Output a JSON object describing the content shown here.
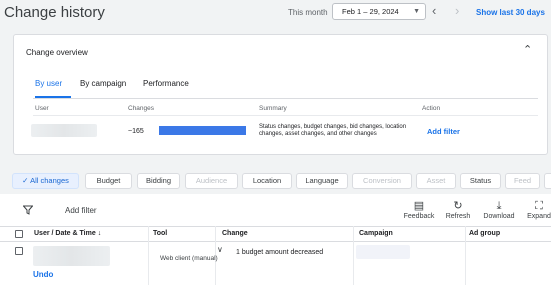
{
  "header": {
    "title": "Change history",
    "range_label": "This month",
    "date_range": "Feb 1 – 29, 2024",
    "show_last": "Show last 30 days"
  },
  "overview": {
    "title": "Change overview",
    "tabs": [
      {
        "label": "By user",
        "active": true
      },
      {
        "label": "By campaign",
        "active": false
      },
      {
        "label": "Performance",
        "active": false
      }
    ],
    "columns": {
      "user": "User",
      "changes": "Changes",
      "summary": "Summary",
      "action": "Action"
    },
    "row": {
      "changes": "~165",
      "summary": "Status changes, budget changes, bid changes, location changes, asset changes, and other changes",
      "action": "Add filter"
    }
  },
  "chips": [
    {
      "label": "All changes",
      "state": "active"
    },
    {
      "label": "Budget",
      "state": "normal"
    },
    {
      "label": "Bidding",
      "state": "normal"
    },
    {
      "label": "Audience",
      "state": "disabled"
    },
    {
      "label": "Location",
      "state": "normal"
    },
    {
      "label": "Language",
      "state": "normal"
    },
    {
      "label": "Conversion",
      "state": "disabled"
    },
    {
      "label": "Asset",
      "state": "disabled"
    },
    {
      "label": "Status",
      "state": "normal"
    },
    {
      "label": "Feed",
      "state": "disabled"
    }
  ],
  "toolbar": {
    "add_filter": "Add filter",
    "feedback": "Feedback",
    "refresh": "Refresh",
    "download": "Download",
    "expand": "Expand"
  },
  "table": {
    "columns": {
      "user": "User / Date & Time",
      "tool": "Tool",
      "change": "Change",
      "campaign": "Campaign",
      "ad_group": "Ad group"
    },
    "rows": [
      {
        "tool": "Web client (manual)",
        "change": "1 budget amount decreased",
        "undo": "Undo"
      }
    ]
  },
  "colors": {
    "accent": "#1a73e8",
    "bar": "#3b78e7",
    "chip_active_bg": "#e8f0fe"
  }
}
